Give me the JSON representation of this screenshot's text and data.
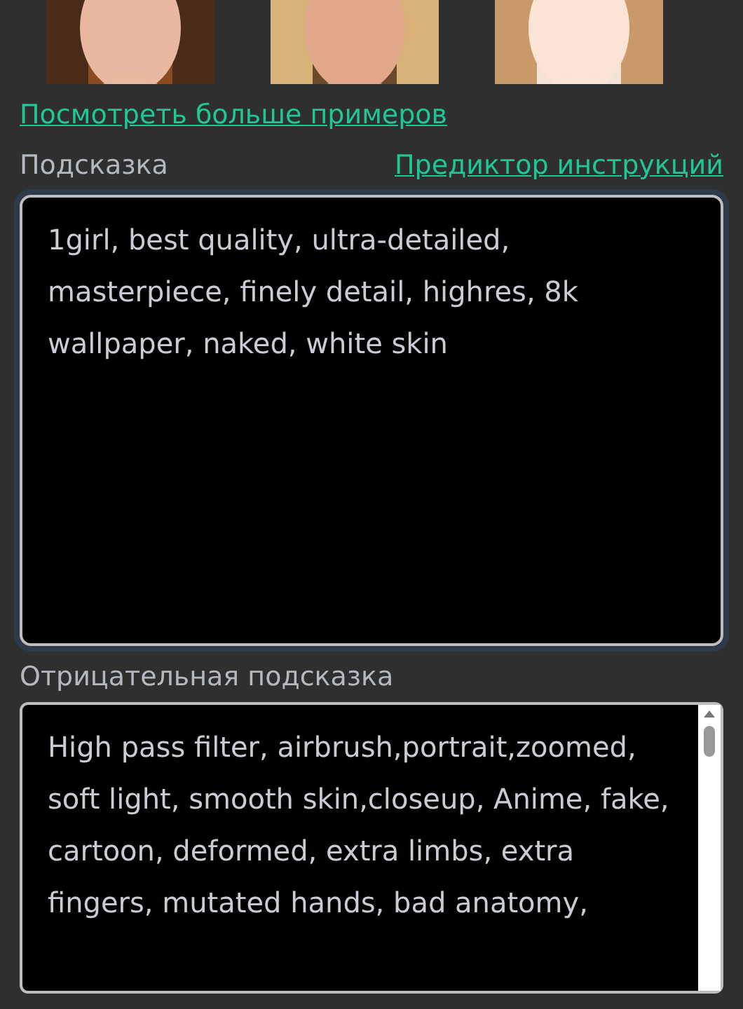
{
  "more_examples_link": "Посмотреть больше примеров",
  "prompt": {
    "label": "Подсказка",
    "predictor_link": "Предиктор инструкций",
    "value": "1girl, best quality, ultra-detailed, masterpiece, finely detail, highres, 8k wallpaper, naked, white skin"
  },
  "negative_prompt": {
    "label": "Отрицательная подсказка",
    "value": "High pass filter, airbrush,portrait,zoomed, soft light, smooth skin,closeup, Anime, fake, cartoon, deformed, extra limbs, extra fingers, mutated hands, bad anatomy,"
  }
}
